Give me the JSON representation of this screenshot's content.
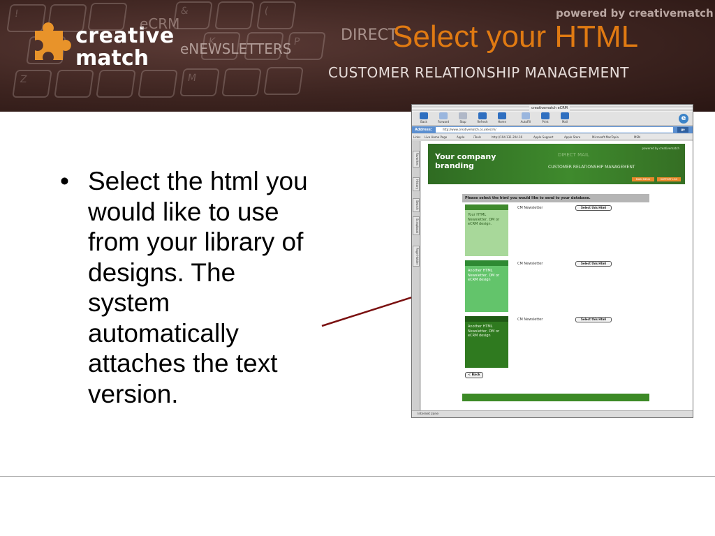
{
  "banner": {
    "logo_line1": "creative",
    "logo_line2": "match",
    "bg_word_ecrm": "eCRM",
    "bg_word_newsletters": "eNEWSLETTERS",
    "bg_word_direct": "DIRECT",
    "crm_tagline": "CUSTOMER RELATIONSHIP MANAGEMENT",
    "powered_by": "powered by creativematch",
    "puzzle_color": "#e8932a"
  },
  "slide": {
    "title": "Select your HTML",
    "title_color": "#e07a12",
    "bullet_char": "•",
    "bullet": "Select the html you would like to use from your library of designs. The system automatically attaches the text version."
  },
  "arrow": {
    "color": "#7a1010"
  },
  "browser": {
    "window_title": "creativematch eCRM",
    "toolbar": [
      {
        "label": "Back",
        "icon": "back-arrow-icon"
      },
      {
        "label": "Forward",
        "icon": "forward-arrow-icon"
      },
      {
        "label": "Stop",
        "icon": "stop-icon"
      },
      {
        "label": "Refresh",
        "icon": "refresh-icon"
      },
      {
        "label": "Home",
        "icon": "home-icon"
      },
      {
        "label": "AutoFill",
        "icon": "autofill-icon"
      },
      {
        "label": "Print",
        "icon": "print-icon"
      },
      {
        "label": "Mail",
        "icon": "mail-icon"
      }
    ],
    "address_label": "Address:",
    "address_url": "http://www.creativematch.co.uk/ecrm/",
    "go_label": "go",
    "links_label": "Links",
    "links": [
      "Live Home Page",
      "Apple",
      "iTools",
      "http://194.131.204.16",
      "Apple Support",
      "Apple Store",
      "Microsoft MacTopia",
      "MSN"
    ],
    "side_tabs": [
      "Favorites",
      "History",
      "Search",
      "Scrapbook",
      "Page Holder"
    ],
    "status_text": "Internet zone"
  },
  "site": {
    "branding": "Your company branding",
    "powered": "powered by creativematch",
    "direct": "DIRECT MAIL",
    "crm": "CUSTOMER RELATIONSHIP MANAGEMENT",
    "orange_buttons": [
      "MAIN MENU",
      "SUPPORT LOG"
    ],
    "instruction": "Please select the html you would like to send to your database.",
    "designs": [
      {
        "thumb_text": "Your HTML Newsletter, DM or eCRM design.",
        "name": "CM Newsletter",
        "button": "Select this Html",
        "bg": "#a8d89a",
        "head": "#3f8a2d",
        "text_color": "#2b5a1e"
      },
      {
        "thumb_text": "Another HTML Newsletter, DM or eCRM design",
        "name": "CM Newsletter",
        "button": "Select this Html",
        "bg": "#63c46b",
        "head": "#2e8a33",
        "text_color": "#ffffff"
      },
      {
        "thumb_text": "Another HTML Newsletter, DM or eCRM design",
        "name": "CM Newsletter",
        "button": "Select this Html",
        "bg": "#2f7a1f",
        "head": "#1f5a14",
        "text_color": "#e8f4e0"
      }
    ],
    "back_label": "< Back"
  }
}
